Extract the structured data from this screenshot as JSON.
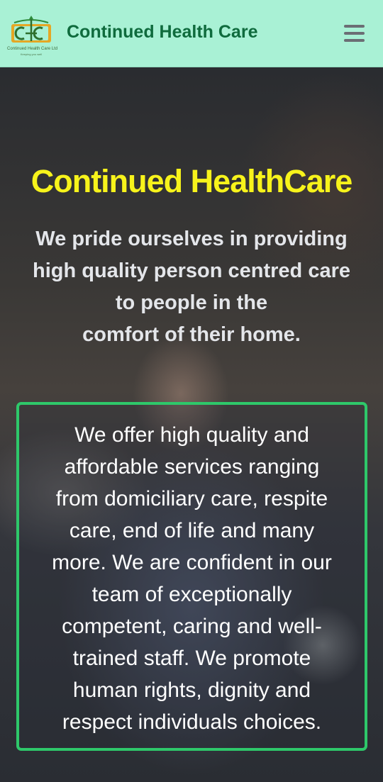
{
  "header": {
    "brand_name": "Continued Health Care",
    "logo": {
      "monogram": "CHC",
      "company_name": "Continued Health Care Ltd",
      "tagline": "Keeping you well"
    },
    "menu_icon": "hamburger-menu-icon"
  },
  "hero": {
    "title": "Continued HealthCare",
    "subtitle_lines": [
      "We pride ourselves in providing",
      "high quality person centred care",
      "to people in the",
      "comfort of their home."
    ],
    "info_lines": [
      "We offer high quality and",
      "affordable services ranging",
      "from domiciliary care, respite",
      "care, end of life and many",
      "more. We are confident in our",
      "team of exceptionally",
      "competent, caring and well-",
      "trained staff. We promote",
      "human rights, dignity and",
      "respect individuals choices."
    ]
  },
  "colors": {
    "header_bg": "#a9f1d5",
    "brand_text": "#0f6b3d",
    "hero_title": "#f7f31b",
    "box_border": "#2ec86a",
    "menu_icon": "#6b6e74"
  }
}
